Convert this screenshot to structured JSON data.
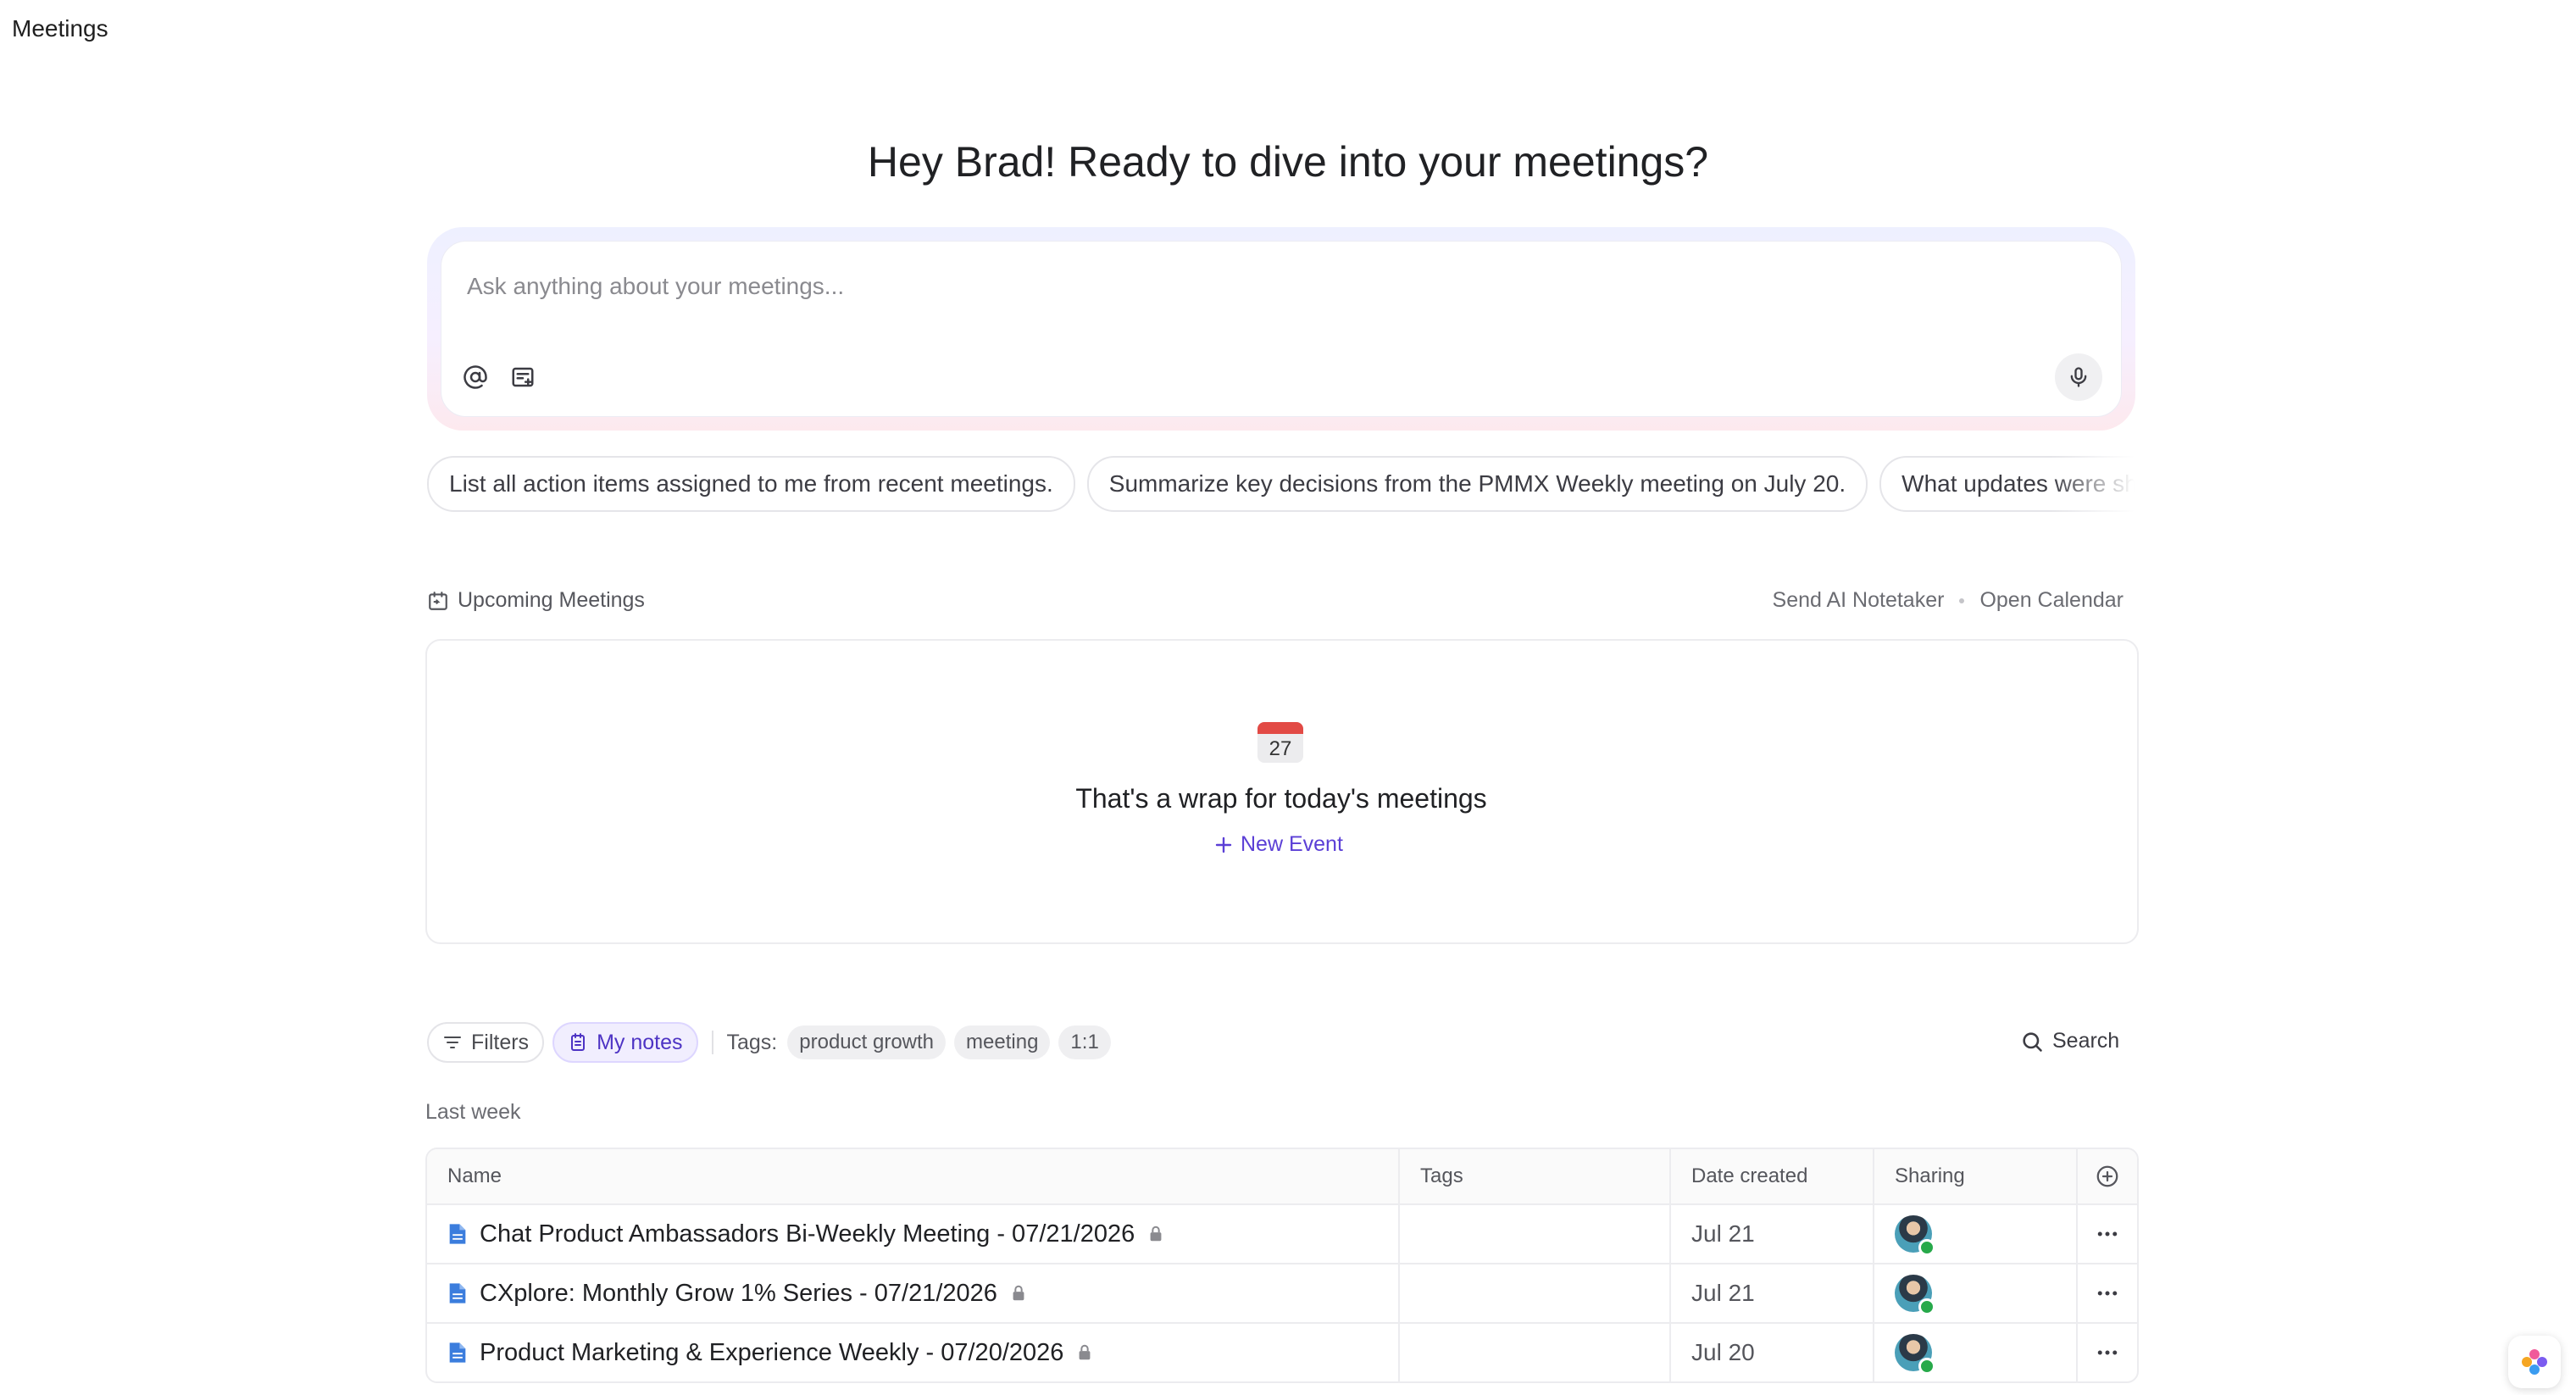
{
  "page": {
    "title": "Meetings"
  },
  "greeting": "Hey Brad! Ready to dive into your meetings?",
  "ask": {
    "placeholder": "Ask anything about your meetings..."
  },
  "suggestions": [
    "List all action items assigned to me from recent meetings.",
    "Summarize key decisions from the PMMX Weekly meeting on July 20.",
    "What updates were shared in recent meetings?"
  ],
  "upcoming": {
    "title": "Upcoming Meetings",
    "send_notetaker": "Send AI Notetaker",
    "open_calendar": "Open Calendar",
    "calendar_day": "27",
    "empty_text": "That's a wrap for today's meetings",
    "new_event": "New Event"
  },
  "filters": {
    "filters_label": "Filters",
    "my_notes_label": "My notes",
    "tags_label": "Tags:",
    "tags": [
      "product growth",
      "meeting",
      "1:1"
    ],
    "search_label": "Search"
  },
  "group": {
    "label": "Last week"
  },
  "table": {
    "columns": {
      "name": "Name",
      "tags": "Tags",
      "date": "Date created",
      "sharing": "Sharing"
    },
    "rows": [
      {
        "name": "Chat Product Ambassadors Bi-Weekly Meeting - 07/21/2026",
        "date": "Jul 21"
      },
      {
        "name": "CXplore: Monthly Grow 1% Series - 07/21/2026",
        "date": "Jul 21"
      },
      {
        "name": "Product Marketing & Experience Weekly - 07/20/2026",
        "date": "Jul 20"
      }
    ]
  },
  "colors": {
    "accent": "#5b3fd6",
    "doc_icon": "#3b7ddd",
    "online": "#27a94a",
    "calendar_red": "#e24a45"
  }
}
